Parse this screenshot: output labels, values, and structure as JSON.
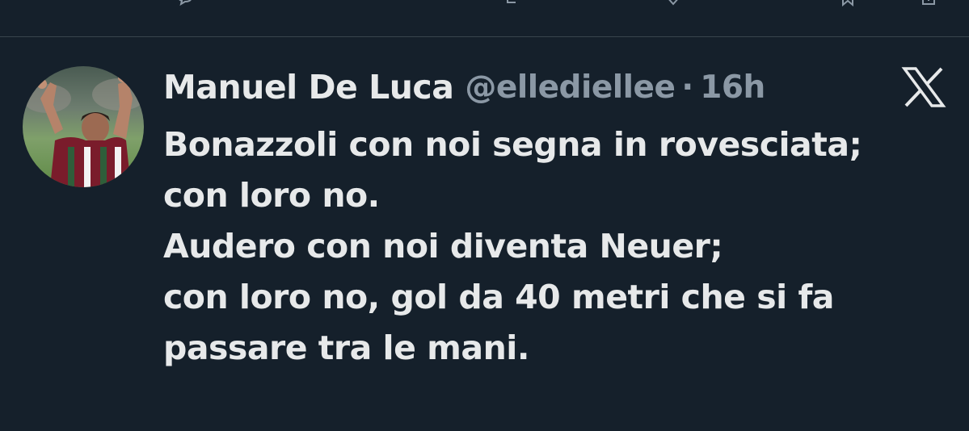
{
  "theme": {
    "background": "#15202b",
    "divider": "#38444d",
    "text_primary": "#e7e9ea",
    "text_secondary": "#8b98a5"
  },
  "top_actions": {
    "icons": [
      "reply-icon",
      "retweet-icon",
      "like-icon",
      "bookmark-icon",
      "share-icon"
    ]
  },
  "tweet": {
    "author_name": "Manuel De Luca",
    "handle": "@ellediellee",
    "separator": "·",
    "timestamp": "16h",
    "avatar_icon": "profile-photo",
    "brand_icon": "x-logo-icon",
    "body_lines": [
      "Bonazzoli con noi segna in rovesciata;",
      "con loro no.",
      "Audero con noi diventa Neuer;",
      "con loro no, gol da 40 metri che si fa",
      "passare tra le mani."
    ]
  }
}
